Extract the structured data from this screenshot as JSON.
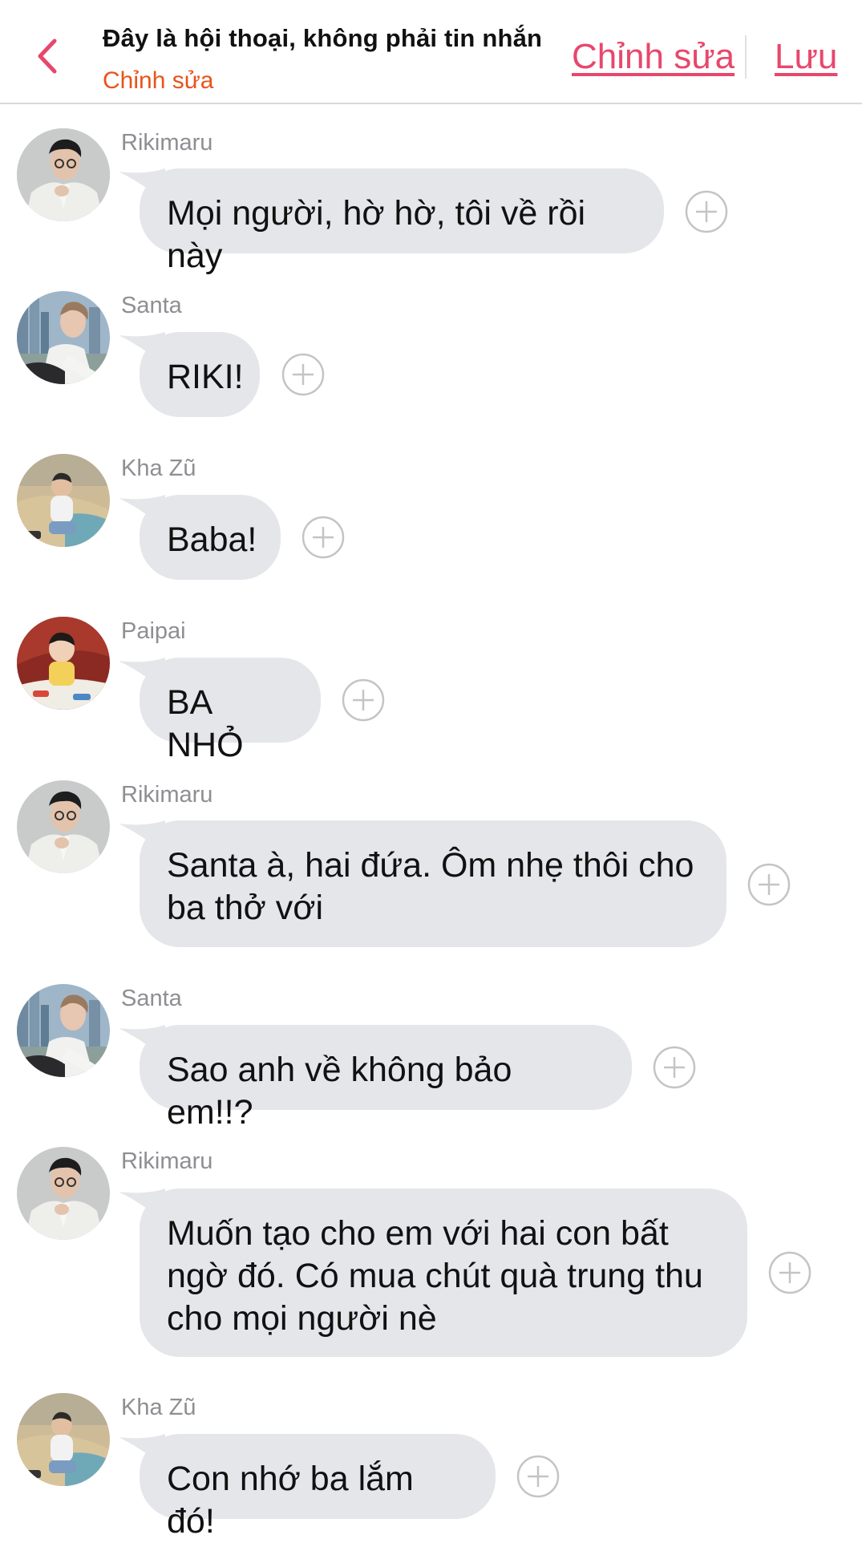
{
  "header": {
    "title": "Đây là hội thoại, không phải tin nhắn",
    "subtitle": "Chỉnh sửa",
    "edit_label": "Chỉnh sửa",
    "save_label": "Lưu"
  },
  "messages": [
    {
      "sender": "Rikimaru",
      "text": "Mọi người, hờ hờ, tôi về rồi này"
    },
    {
      "sender": "Santa",
      "text": "RIKI!"
    },
    {
      "sender": "Kha Zũ",
      "text": "Baba!"
    },
    {
      "sender": "Paipai",
      "text": "BA NHỎ"
    },
    {
      "sender": "Rikimaru",
      "text": "Santa à, hai đứa. Ôm nhẹ thôi cho ba thở với"
    },
    {
      "sender": "Santa",
      "text": "Sao anh về không bảo em!!?"
    },
    {
      "sender": "Rikimaru",
      "text": "Muốn tạo cho em với hai con bất ngờ đó. Có mua chút quà trung thu cho mọi người nè"
    },
    {
      "sender": "Kha Zũ",
      "text": "Con nhớ ba lắm đó!"
    }
  ],
  "colors": {
    "accent": "#e8476c",
    "subtitle": "#e8541c",
    "bubble": "#e5e6ea",
    "sender": "#8e8e93"
  },
  "icons": {
    "back": "chevron-left-icon",
    "add": "plus-circle-icon"
  }
}
